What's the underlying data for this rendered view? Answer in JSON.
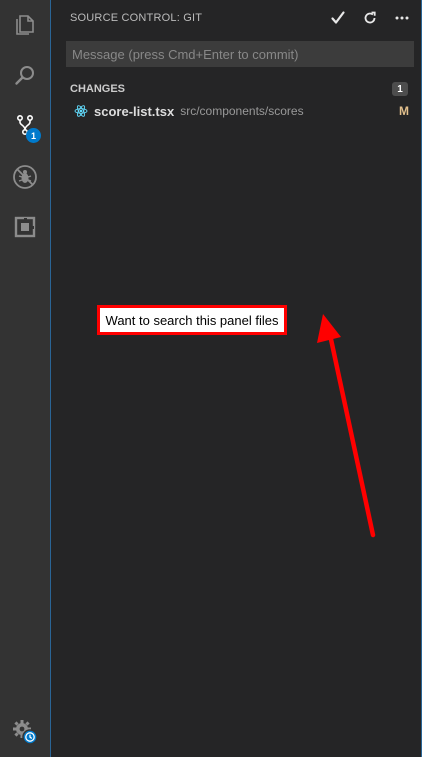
{
  "activity_bar": {
    "items": [
      {
        "name": "explorer-icon"
      },
      {
        "name": "search-icon"
      },
      {
        "name": "source-control-icon",
        "badge": "1"
      },
      {
        "name": "debug-icon"
      },
      {
        "name": "extensions-icon"
      }
    ],
    "settings": {
      "name": "gear-icon"
    }
  },
  "sidebar": {
    "title": "SOURCE CONTROL: GIT",
    "actions": [
      "commit-check-icon",
      "refresh-icon",
      "more-icon"
    ],
    "message_placeholder": "Message (press Cmd+Enter to commit)",
    "message_value": "",
    "changes": {
      "title": "CHANGES",
      "count": "1",
      "files": [
        {
          "name": "score-list.tsx",
          "path": "src/components/scores",
          "status": "M",
          "icon": "react-icon"
        }
      ]
    }
  },
  "annotation": {
    "text": "Want to search this panel files",
    "color": "#ff0000"
  },
  "colors": {
    "accent": "#007acc",
    "modified": "#e2c08d",
    "react": "#61dafb"
  }
}
